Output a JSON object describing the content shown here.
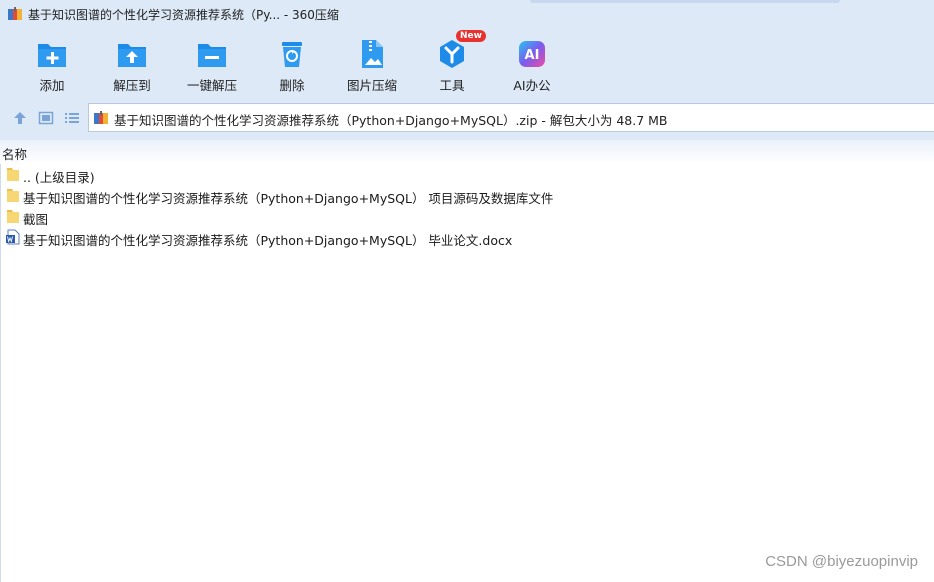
{
  "window": {
    "title": "基于知识图谱的个性化学习资源推荐系统（Py... - 360压缩"
  },
  "toolbar": {
    "items": [
      {
        "label": "添加",
        "icon": "add-icon"
      },
      {
        "label": "解压到",
        "icon": "extract-to-icon"
      },
      {
        "label": "一键解压",
        "icon": "one-click-extract-icon"
      },
      {
        "label": "删除",
        "icon": "delete-icon"
      },
      {
        "label": "图片压缩",
        "icon": "image-compress-icon"
      },
      {
        "label": "工具",
        "icon": "tools-icon",
        "badge": "New"
      },
      {
        "label": "AI办公",
        "icon": "ai-office-icon",
        "icon_text": "AI"
      }
    ]
  },
  "address": {
    "path": "基于知识图谱的个性化学习资源推荐系统（Python+Django+MySQL）.zip - 解包大小为 48.7 MB"
  },
  "list": {
    "column_name": "名称",
    "rows": [
      {
        "name": ".. (上级目录)",
        "type": "folder"
      },
      {
        "name": "基于知识图谱的个性化学习资源推荐系统（Python+Django+MySQL） 项目源码及数据库文件",
        "type": "folder"
      },
      {
        "name": "截图",
        "type": "folder"
      },
      {
        "name": "基于知识图谱的个性化学习资源推荐系统（Python+Django+MySQL） 毕业论文.docx",
        "type": "word-doc"
      }
    ]
  },
  "watermark": "CSDN @biyezuopinvip",
  "colors": {
    "chrome_bg": "#dde9f7",
    "icon_blue": "#1e8be8",
    "folder_yellow": "#f7d774",
    "badge_red": "#e8322f"
  }
}
